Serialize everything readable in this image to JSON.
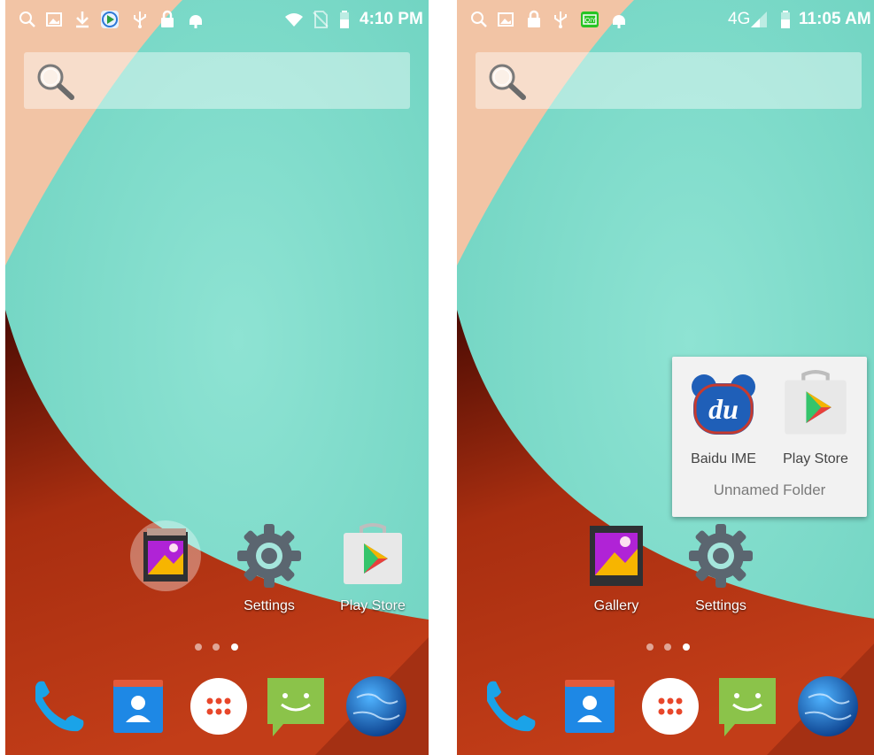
{
  "left_screen": {
    "status_bar": {
      "time": "4:10 PM",
      "icons": [
        "search-icon",
        "image-icon",
        "download-icon",
        "video-app-icon",
        "usb-icon",
        "lock-icon",
        "android-debug-icon",
        "wifi-icon",
        "no-sim-icon",
        "battery-icon"
      ]
    },
    "search_bar": {
      "icon": "search-icon"
    },
    "apps": [
      {
        "name": "gallery",
        "label": "",
        "dragging": true
      },
      {
        "name": "settings",
        "label": "Settings"
      },
      {
        "name": "play-store",
        "label": "Play Store"
      }
    ],
    "page_indicator": {
      "count": 3,
      "active": 3
    },
    "dock": [
      "phone-icon",
      "contacts-icon",
      "app-drawer-icon",
      "messaging-icon",
      "browser-icon"
    ]
  },
  "right_screen": {
    "status_bar": {
      "time": "11:05 AM",
      "network": "4G",
      "icons": [
        "search-icon",
        "image-icon",
        "lock-icon",
        "usb-icon",
        "iqiyi-icon",
        "android-debug-icon",
        "signal-icon",
        "battery-icon"
      ]
    },
    "search_bar": {
      "icon": "search-icon"
    },
    "folder": {
      "name": "Unnamed Folder",
      "apps": [
        {
          "name": "baidu-ime",
          "label": "Baidu IME"
        },
        {
          "name": "play-store",
          "label": "Play Store"
        }
      ]
    },
    "apps": [
      {
        "name": "gallery",
        "label": "Gallery"
      },
      {
        "name": "settings",
        "label": "Settings"
      }
    ],
    "page_indicator": {
      "count": 3,
      "active": 3
    },
    "dock": [
      "phone-icon",
      "contacts-icon",
      "app-drawer-icon",
      "messaging-icon",
      "browser-icon"
    ]
  },
  "colors": {
    "teal": "#7fdccb",
    "peach": "#f2c4a5",
    "red": "#b63413",
    "dark_red": "#5a0f05"
  }
}
